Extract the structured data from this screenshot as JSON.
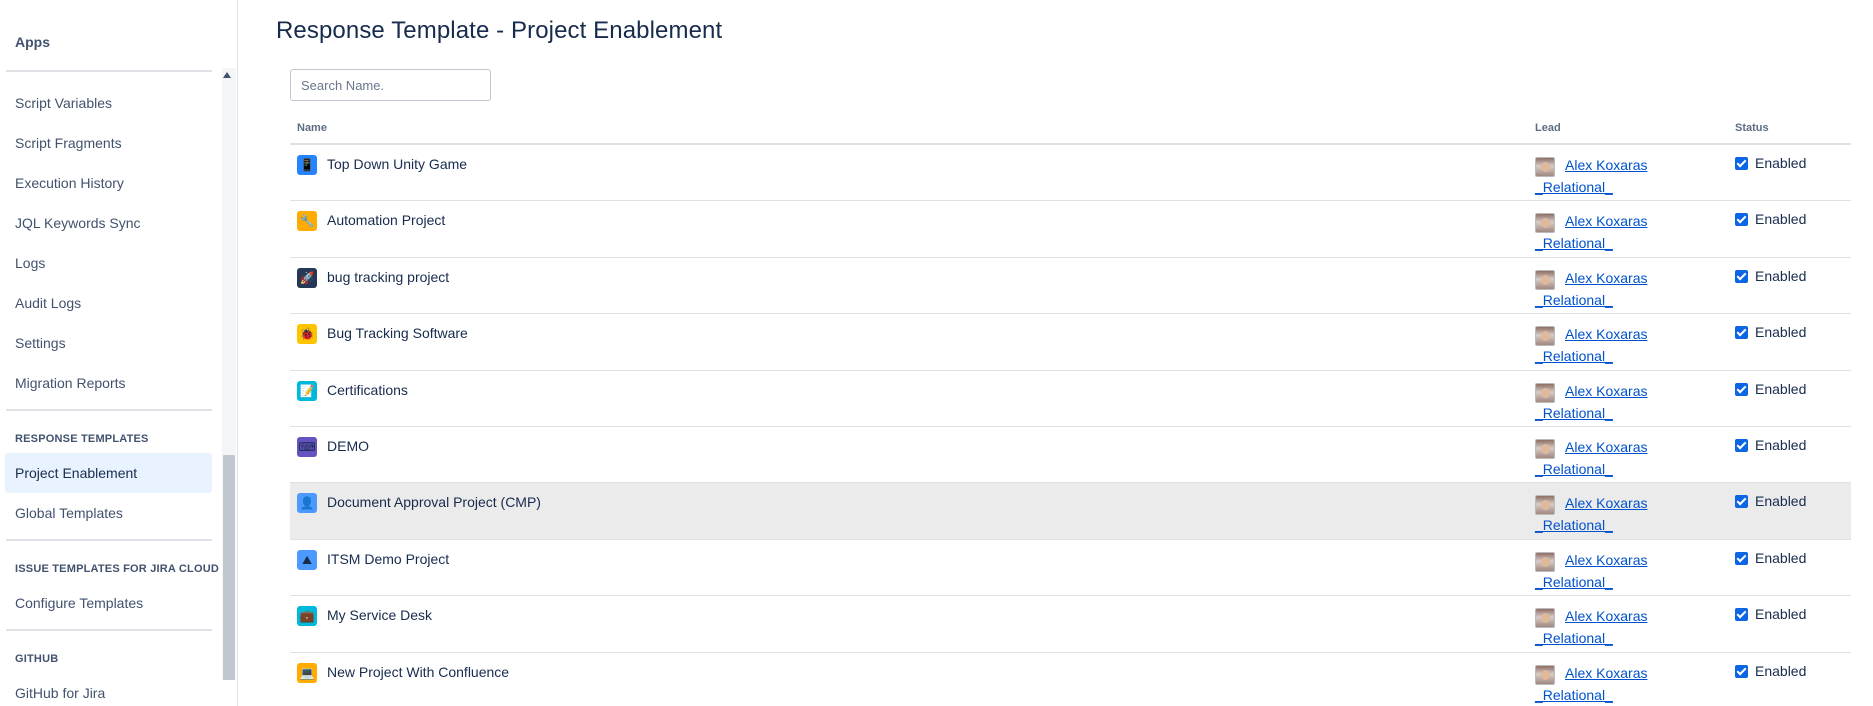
{
  "sidebar": {
    "apps_title": "Apps",
    "items_top": [
      {
        "label": "Script Variables"
      },
      {
        "label": "Script Fragments"
      },
      {
        "label": "Execution History"
      },
      {
        "label": "JQL Keywords Sync"
      },
      {
        "label": "Logs"
      },
      {
        "label": "Audit Logs"
      },
      {
        "label": "Settings"
      },
      {
        "label": "Migration Reports"
      }
    ],
    "section_response_templates": {
      "heading": "RESPONSE TEMPLATES",
      "items": [
        {
          "label": "Project Enablement",
          "selected": true
        },
        {
          "label": "Global Templates",
          "selected": false
        }
      ]
    },
    "section_issue_templates": {
      "heading": "ISSUE TEMPLATES FOR JIRA CLOUD",
      "items": [
        {
          "label": "Configure Templates"
        }
      ]
    },
    "section_github": {
      "heading": "GITHUB",
      "items": [
        {
          "label": "GitHub for Jira"
        }
      ]
    }
  },
  "main": {
    "title": "Response Template - Project Enablement",
    "search": {
      "placeholder": "Search Name.",
      "value": ""
    },
    "columns": {
      "name": "Name",
      "lead": "Lead",
      "status": "Status"
    },
    "rows": [
      {
        "name": "Top Down Unity Game",
        "icon": "phone-icon",
        "icon_bg": "#2684ff",
        "icon_glyph": "📱",
        "lead_name": "Alex Koxaras",
        "lead_sub": "_Relational_",
        "status": "Enabled",
        "checked": true
      },
      {
        "name": "Automation Project",
        "icon": "wrench-icon",
        "icon_bg": "#ffab00",
        "icon_glyph": "🔧",
        "lead_name": "Alex Koxaras",
        "lead_sub": "_Relational_",
        "status": "Enabled",
        "checked": true
      },
      {
        "name": "bug tracking project",
        "icon": "rocket-icon",
        "icon_bg": "#253858",
        "icon_glyph": "🚀",
        "lead_name": "Alex Koxaras",
        "lead_sub": "_Relational_",
        "status": "Enabled",
        "checked": true
      },
      {
        "name": "Bug Tracking Software",
        "icon": "bug-icon",
        "icon_bg": "#ffc400",
        "icon_glyph": "🐞",
        "lead_name": "Alex Koxaras",
        "lead_sub": "_Relational_",
        "status": "Enabled",
        "checked": true
      },
      {
        "name": "Certifications",
        "icon": "notepad-icon",
        "icon_bg": "#00b8d9",
        "icon_glyph": "📝",
        "lead_name": "Alex Koxaras",
        "lead_sub": "_Relational_",
        "status": "Enabled",
        "checked": true
      },
      {
        "name": "DEMO",
        "icon": "code-icon",
        "icon_bg": "#6554c0",
        "icon_glyph": "⌨",
        "lead_name": "Alex Koxaras",
        "lead_sub": "_Relational_",
        "status": "Enabled",
        "checked": true
      },
      {
        "name": "Document Approval Project (CMP)",
        "icon": "person-icon",
        "icon_bg": "#4c9aff",
        "icon_glyph": "👤",
        "lead_name": "Alex Koxaras",
        "lead_sub": "_Relational_",
        "status": "Enabled",
        "checked": true
      },
      {
        "name": "ITSM Demo Project",
        "icon": "mountain-icon",
        "icon_bg": "#4c9aff",
        "icon_glyph": "⛰",
        "lead_name": "Alex Koxaras",
        "lead_sub": "_Relational_",
        "status": "Enabled",
        "checked": true
      },
      {
        "name": "My Service Desk",
        "icon": "desk-icon",
        "icon_bg": "#00b8d9",
        "icon_glyph": "💼",
        "lead_name": "Alex Koxaras",
        "lead_sub": "_Relational_",
        "status": "Enabled",
        "checked": true
      },
      {
        "name": "New Project With Confluence",
        "icon": "screen-icon",
        "icon_bg": "#ffab00",
        "icon_glyph": "💻",
        "lead_name": "Alex Koxaras",
        "lead_sub": "_Relational_",
        "status": "Enabled",
        "checked": true
      }
    ]
  },
  "colors": {
    "link": "#0052cc",
    "checkbox": "#0c66e4",
    "selected_bg": "#e9f2ff",
    "hover_row_bg": "#ebebeb"
  }
}
